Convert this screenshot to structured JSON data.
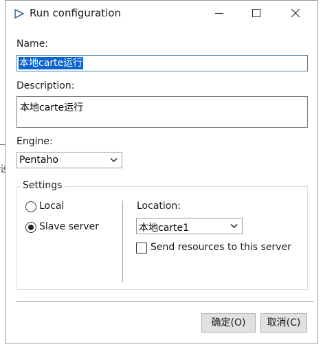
{
  "window": {
    "title": "Run configuration"
  },
  "form": {
    "name_label": "Name:",
    "name_value": "本地carte运行",
    "description_label": "Description:",
    "description_value": "本地carte运行",
    "engine_label": "Engine:",
    "engine_value": "Pentaho"
  },
  "settings": {
    "group_title": "Settings",
    "radio_local_label": "Local",
    "radio_slave_label": "Slave server",
    "selected": "Slave server",
    "location_label": "Location:",
    "location_value": "本地carte1",
    "send_resources_label": "Send resources to this server",
    "send_resources_checked": false
  },
  "buttons": {
    "ok_label": "确定(O)",
    "cancel_label": "取消(C)"
  },
  "icons": {
    "app": "play-triangle-icon",
    "minimize": "minimize-icon",
    "maximize": "maximize-icon",
    "close": "close-icon",
    "dropdown": "chevron-down-icon"
  },
  "colors": {
    "selection": "#0a64cc",
    "focus_border": "#3c7fb1",
    "app_icon": "#3a6ea5"
  }
}
